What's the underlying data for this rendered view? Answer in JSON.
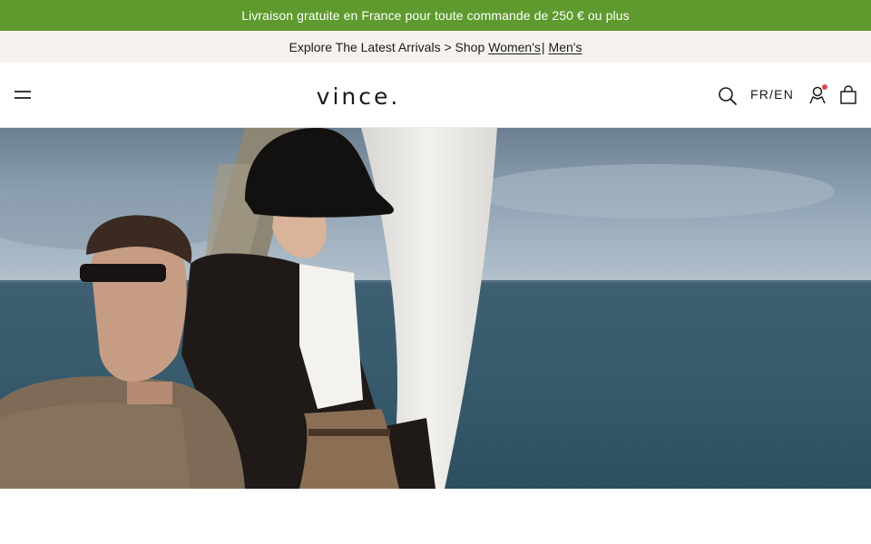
{
  "promo": {
    "text": "Livraison gratuite en France pour toute commande de 250 € ou plus"
  },
  "explore": {
    "lead": "Explore The Latest Arrivals > Shop",
    "womens_label": "Women's",
    "separator": "|",
    "mens_label": "Men's"
  },
  "header": {
    "logo_text": "vince.",
    "language": "FR/EN",
    "icons": {
      "menu": "hamburger-menu-icon",
      "search": "search-icon",
      "account": "account-icon",
      "cart": "shopping-bag-icon"
    }
  },
  "colors": {
    "promo_bg": "#5e9a2e",
    "explore_bg": "#f6f3ee",
    "notification_dot": "#d94b4b"
  }
}
